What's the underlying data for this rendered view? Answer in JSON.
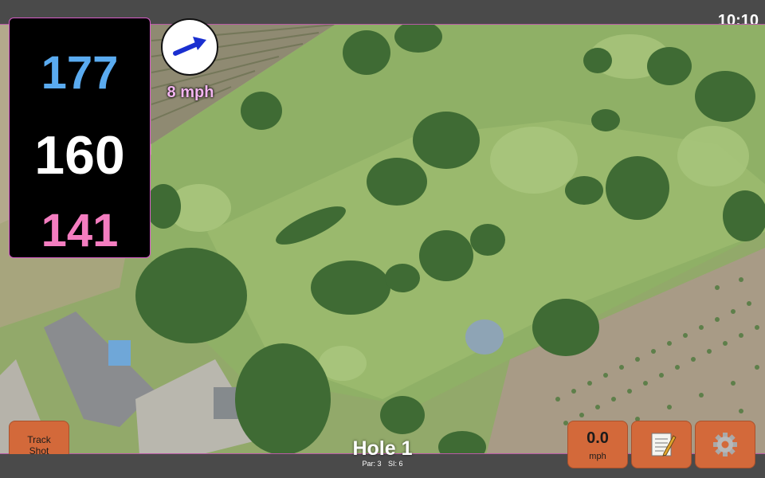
{
  "status": {
    "time": "10:10"
  },
  "distances": {
    "back": "177",
    "middle": "160",
    "front": "141"
  },
  "wind": {
    "speed": "8 mph"
  },
  "buttons": {
    "track_line1": "Track",
    "track_line2": "Shot",
    "speed_value": "0.0",
    "speed_unit": "mph"
  },
  "hole": {
    "title": "Hole 1",
    "par": "Par: 3",
    "si": "SI: 6"
  },
  "colors": {
    "back": "#5aabf0",
    "middle": "#ffffff",
    "front": "#f47dc0",
    "wind_text": "#f3b5f0",
    "button": "#d3693a",
    "accent_border": "#d75cc9"
  },
  "icons": {
    "wind": "wind-direction-arrow-icon",
    "notes": "notepad-icon",
    "settings": "gear-icon"
  }
}
